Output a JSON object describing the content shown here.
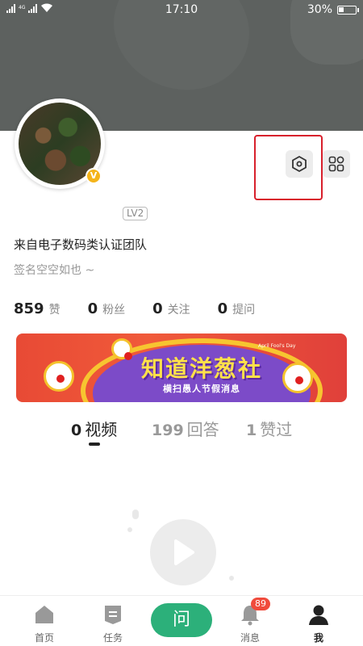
{
  "status_bar": {
    "network": "4G",
    "time": "17:10",
    "battery_text": "30%",
    "battery_level": 0.3
  },
  "profile": {
    "verified_badge": "V",
    "level": "LV2",
    "team": "来自电子数码类认证团队",
    "signature": "签名空空如也 ~",
    "stats": [
      {
        "num": "859",
        "label": "赞"
      },
      {
        "num": "0",
        "label": "粉丝"
      },
      {
        "num": "0",
        "label": "关注"
      },
      {
        "num": "0",
        "label": "提问"
      }
    ]
  },
  "header_actions": {
    "settings_icon": "hexagon-settings-icon",
    "apps_icon": "grid-apps-icon"
  },
  "banner": {
    "title": "知道洋葱社",
    "subtitle": "横扫愚人节假消息",
    "english": "April Fool's Day"
  },
  "tabs": [
    {
      "num": "0",
      "label": "视频"
    },
    {
      "num": "199",
      "label": "回答"
    },
    {
      "num": "1",
      "label": "赞过"
    }
  ],
  "bottom_nav": {
    "home": "首页",
    "tasks": "任务",
    "ask": "问",
    "messages": "消息",
    "messages_badge": "89",
    "me": "我"
  },
  "colors": {
    "header_bg": "#5d615f",
    "accent_green": "#2cb07a",
    "highlight_red": "#d8202c",
    "badge_red": "#f04b3c",
    "verified_gold": "#f4b41a"
  }
}
